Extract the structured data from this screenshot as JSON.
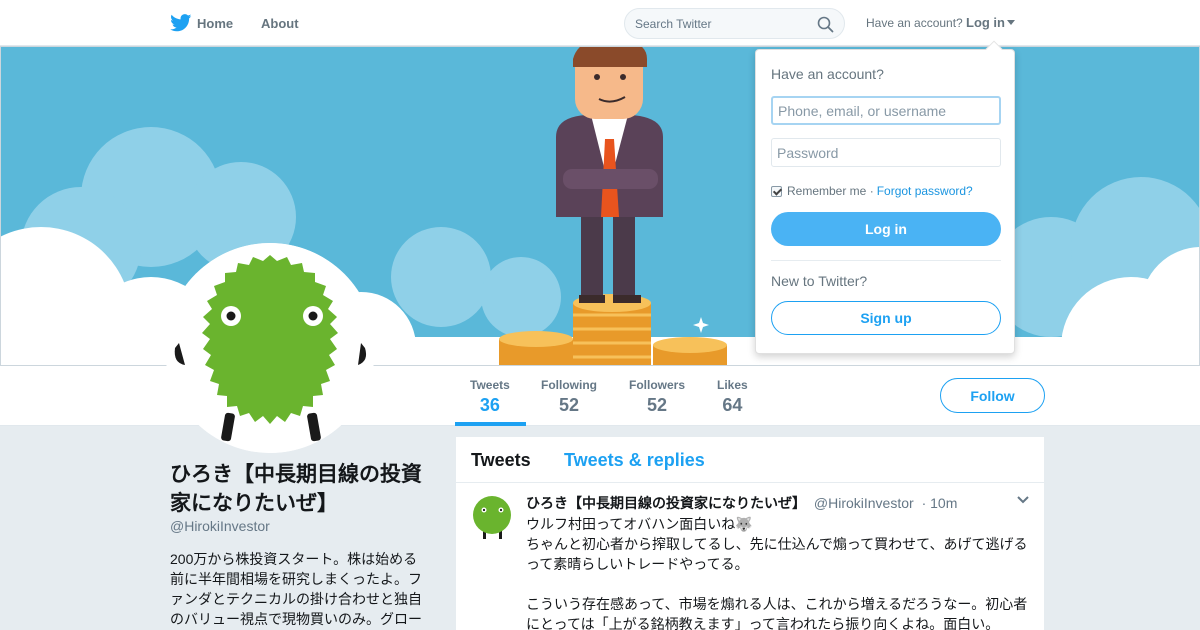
{
  "nav": {
    "home_label": "Home",
    "about_label": "About",
    "search_placeholder": "Search Twitter",
    "have_account": "Have an account?",
    "login_label": "Log in"
  },
  "profile": {
    "name": "ひろき【中長期目線の投資家になりたいぜ】",
    "handle": "@HirokiInvestor",
    "bio": "200万から株投資スタート。株は始める前に半年間相場を研究しまくったよ。ファンダとテクニカルの掛け合わせと独自のバリュー視点で現物買いのみ。グロー"
  },
  "stats": [
    {
      "label": "Tweets",
      "value": "36"
    },
    {
      "label": "Following",
      "value": "52"
    },
    {
      "label": "Followers",
      "value": "52"
    },
    {
      "label": "Likes",
      "value": "64"
    }
  ],
  "follow_label": "Follow",
  "timeline": {
    "tab_tweets": "Tweets",
    "tab_replies": "Tweets & replies"
  },
  "tweet": {
    "name": "ひろき【中長期目線の投資家になりたいぜ】",
    "handle": "@HirokiInvestor",
    "time": "· 10m",
    "lines": [
      "ウルフ村田ってオバハン面白いね🐺",
      "ちゃんと初心者から搾取してるし、先に仕込んで煽って買わせて、あげて逃げるって素晴らしいトレードやってる。",
      "",
      "こういう存在感あって、市場を煽れる人は、これから増えるだろうなー。初心者にとっては「上がる銘柄教えます」って言われたら振り向くよね。面白い。"
    ]
  },
  "login_dropdown": {
    "title": "Have an account?",
    "user_placeholder": "Phone, email, or username",
    "password_placeholder": "Password",
    "remember_label": "Remember me ·",
    "forgot_label": "Forgot password?",
    "login_button": "Log in",
    "new_label": "New to Twitter?",
    "signup_button": "Sign up"
  },
  "colors": {
    "accent": "#1da1f2",
    "login_button": "#4ab3f4",
    "background": "#e6ecf0",
    "banner_sky": "#5ab8d9",
    "avatar_green": "#6ab42e"
  }
}
